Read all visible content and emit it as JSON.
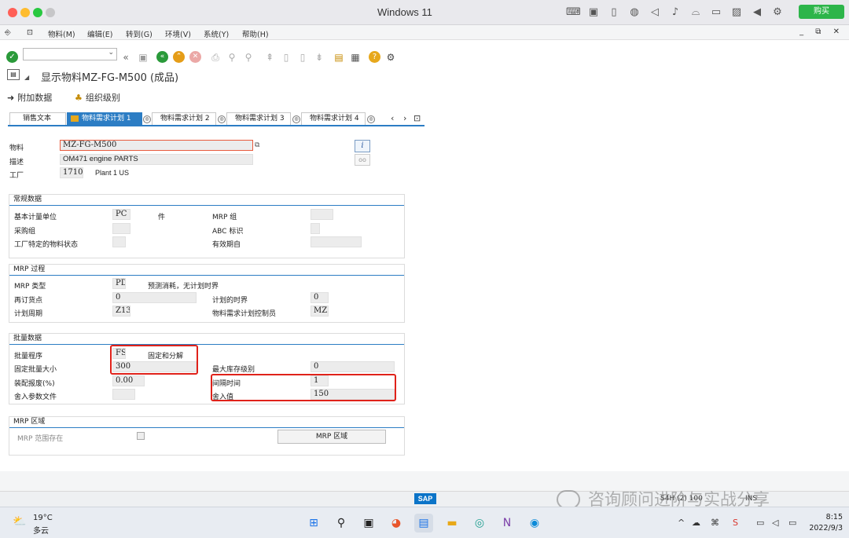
{
  "window": {
    "title": "Windows 11",
    "buy_label": "购买"
  },
  "menu": {
    "items": [
      "物料(M)",
      "编辑(E)",
      "转到(G)",
      "环境(V)",
      "系统(Y)",
      "帮助(H)"
    ],
    "controls": "_ ⧉ ✕"
  },
  "page": {
    "title": "显示物料MZ-FG-M500 (成品)"
  },
  "appbar": {
    "additional_data": "附加数据",
    "org_levels": "组织级别"
  },
  "tabs": [
    "销售文本",
    "物料需求计划 1",
    "物料需求计划 2",
    "物料需求计划 3",
    "物料需求计划 4"
  ],
  "header": {
    "material_label": "物料",
    "material_value": "MZ-FG-M500",
    "desc_label": "描述",
    "desc_value": "OM471 engine PARTS",
    "plant_label": "工厂",
    "plant_value": "1710",
    "plant_name": "Plant 1 US"
  },
  "general": {
    "title": "常规数据",
    "base_uom_label": "基本计量单位",
    "base_uom_value": "PC",
    "base_uom_text": "件",
    "mrp_group_label": "MRP 组",
    "mrp_group_value": "",
    "purch_group_label": "采购组",
    "purch_group_value": "",
    "abc_label": "ABC 标识",
    "abc_value": "",
    "plant_status_label": "工厂特定的物料状态",
    "plant_status_value": "",
    "valid_from_label": "有效期自",
    "valid_from_value": ""
  },
  "mrp_proc": {
    "title": "MRP 过程",
    "mrp_type_label": "MRP 类型",
    "mrp_type_value": "PD",
    "mrp_type_text": "预测消耗，无计划时界",
    "reorder_label": "再订货点",
    "reorder_value": "0",
    "horizon_label": "计划的时界",
    "horizon_value": "0",
    "cycle_label": "计划周期",
    "cycle_value": "Z13",
    "controller_label": "物料需求计划控制员",
    "controller_value": "MZ2"
  },
  "lot": {
    "title": "批量数据",
    "procedure_label": "批量程序",
    "procedure_value": "FS",
    "procedure_text": "固定和分解",
    "fixed_size_label": "固定批量大小",
    "fixed_size_value": "300",
    "max_stock_label": "最大库存级别",
    "max_stock_value": "0",
    "assembly_scrap_label": "装配报废(%)",
    "assembly_scrap_value": "0.00",
    "interval_label": "间隔时间",
    "interval_value": "1",
    "rounding_profile_label": "舍入参数文件",
    "rounding_profile_value": "",
    "rounding_value_label": "舍入值",
    "rounding_value_value": "150"
  },
  "mrp_area": {
    "title": "MRP 区域",
    "exists_label": "MRP 范围存在",
    "button_label": "MRP 区域"
  },
  "status": {
    "sap": "SAP",
    "system": "S4H (2) 100",
    "mode": "INS"
  },
  "watermark": "咨询顾问进阶与实战分享",
  "taskbar": {
    "temp": "19°C",
    "condition": "多云",
    "time": "8:15",
    "date": "2022/9/3"
  }
}
